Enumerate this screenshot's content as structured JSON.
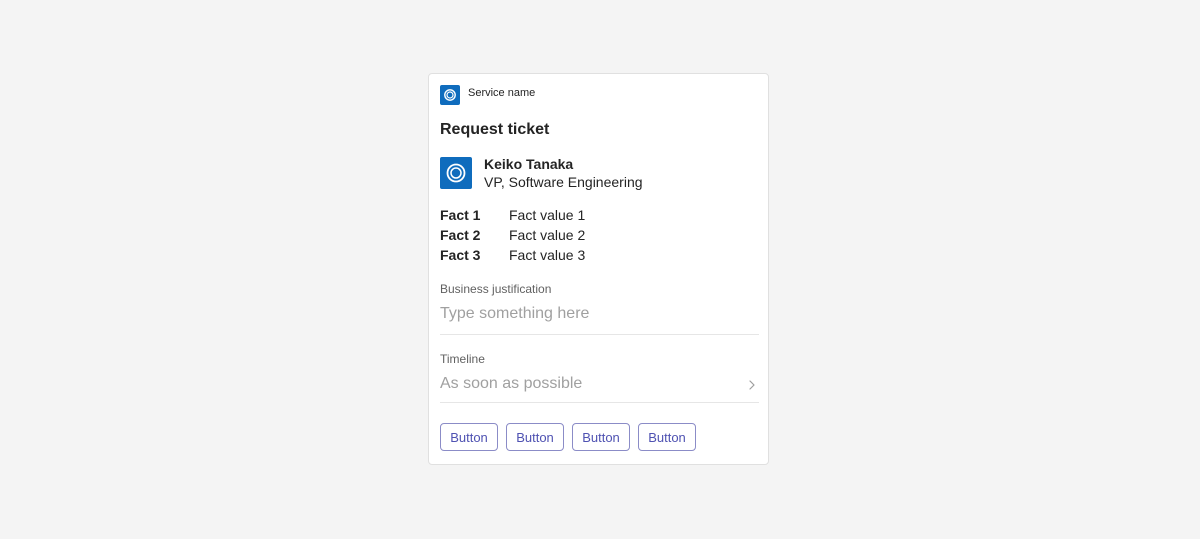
{
  "card": {
    "service_name": "Service name",
    "title": "Request ticket",
    "person": {
      "name": "Keiko Tanaka",
      "role": "VP, Software Engineering"
    },
    "facts": [
      {
        "key": "Fact 1",
        "value": "Fact value 1"
      },
      {
        "key": "Fact 2",
        "value": "Fact value 2"
      },
      {
        "key": "Fact 3",
        "value": "Fact value 3"
      }
    ],
    "justification": {
      "label": "Business justification",
      "placeholder": "Type something here"
    },
    "timeline": {
      "label": "Timeline",
      "value": "As soon as possible"
    },
    "buttons": [
      "Button",
      "Button",
      "Button",
      "Button"
    ]
  },
  "colors": {
    "background": "#f4f4f4",
    "brand": "#0f6cbd",
    "button_border": "#8b8cc7",
    "button_text": "#4f52b2"
  },
  "icons": {
    "service": "service-logo-icon",
    "avatar": "avatar-logo-icon",
    "chevron": "chevron-right-icon"
  }
}
